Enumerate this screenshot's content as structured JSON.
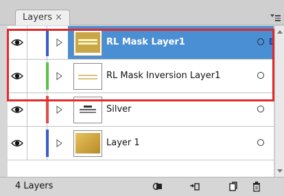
{
  "panel": {
    "tab_label": "Layers",
    "tab_close": "×"
  },
  "layers": [
    {
      "name": "RL Mask Layer1",
      "color": "#3b5bcc",
      "selected": true
    },
    {
      "name": "RL Mask Inversion Layer1",
      "color": "#5cc24a",
      "selected": false
    },
    {
      "name": "Silver",
      "color": "#e04b4b",
      "selected": false
    },
    {
      "name": "Layer 1",
      "color": "#3b5bcc",
      "selected": false
    }
  ],
  "footer": {
    "count_label": "4 Layers"
  },
  "icons": [
    "eye-icon",
    "expand-arrow-icon",
    "target-circle-icon",
    "make-clipping-mask-icon",
    "create-sublayer-icon",
    "new-layer-icon",
    "trash-icon",
    "panel-menu-icon"
  ]
}
